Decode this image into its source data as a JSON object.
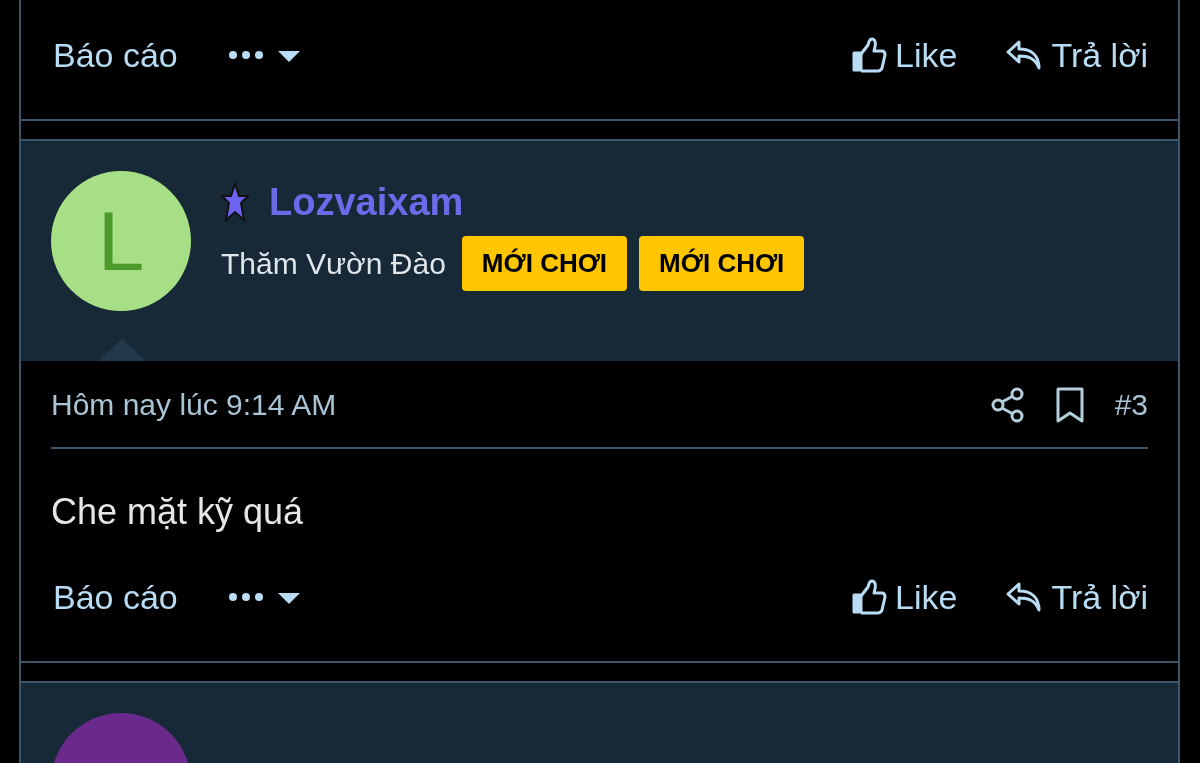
{
  "posts": [
    {
      "footer": {
        "report": "Báo cáo",
        "like": "Like",
        "reply": "Trả lời"
      }
    },
    {
      "author": {
        "avatar_letter": "L",
        "color": "#a6df86",
        "name": "Lozvaixam",
        "title": "Thăm Vườn Đào",
        "badges": [
          "MỚI CHƠI",
          "MỚI CHƠI"
        ]
      },
      "time": "Hôm nay lúc 9:14 AM",
      "number": "#3",
      "content": "Che mặt kỹ quá",
      "footer": {
        "report": "Báo cáo",
        "like": "Like",
        "reply": "Trả lời"
      }
    },
    {
      "author": {
        "color": "#6a2a8c"
      }
    }
  ]
}
